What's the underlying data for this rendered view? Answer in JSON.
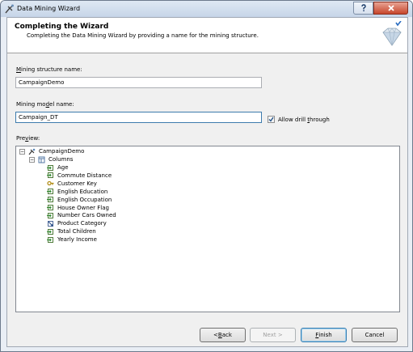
{
  "window": {
    "title": "Data Mining Wizard"
  },
  "header": {
    "title": "Completing the Wizard",
    "subtitle": "Completing the Data Mining Wizard by providing a name for the mining structure."
  },
  "form": {
    "structure_label_pre": "M",
    "structure_label_post": "ining structure name:",
    "structure_value": "CampaignDemo",
    "model_label_pre": "Mining mo",
    "model_label_u": "d",
    "model_label_post": "el name:",
    "model_value": "Campaign_DT",
    "drill_label_pre": "Allow drill ",
    "drill_label_u": "t",
    "drill_label_post": "hrough",
    "drill_checked": true,
    "preview_label_pre": "Pre",
    "preview_label_u": "v",
    "preview_label_post": "iew:"
  },
  "tree": {
    "root": "CampaignDemo",
    "columns_label": "Columns",
    "columns": [
      {
        "name": "Age",
        "icon": "input-column-icon"
      },
      {
        "name": "Commute Distance",
        "icon": "input-column-icon"
      },
      {
        "name": "Customer Key",
        "icon": "key-column-icon"
      },
      {
        "name": "English Education",
        "icon": "input-column-icon"
      },
      {
        "name": "English Occupation",
        "icon": "input-column-icon"
      },
      {
        "name": "House Owner Flag",
        "icon": "input-column-icon"
      },
      {
        "name": "Number Cars Owned",
        "icon": "input-column-icon"
      },
      {
        "name": "Product Category",
        "icon": "predict-column-icon"
      },
      {
        "name": "Total Children",
        "icon": "input-column-icon"
      },
      {
        "name": "Yearly Income",
        "icon": "input-column-icon"
      }
    ]
  },
  "buttons": {
    "back_pre": "< ",
    "back_u": "B",
    "back_post": "ack",
    "next": "Next >",
    "finish_u": "F",
    "finish_post": "inish",
    "cancel": "Cancel"
  },
  "colors": {
    "accent": "#3c7fb1",
    "header_bg": "#ffffff",
    "client_bg": "#f0f0f0"
  }
}
